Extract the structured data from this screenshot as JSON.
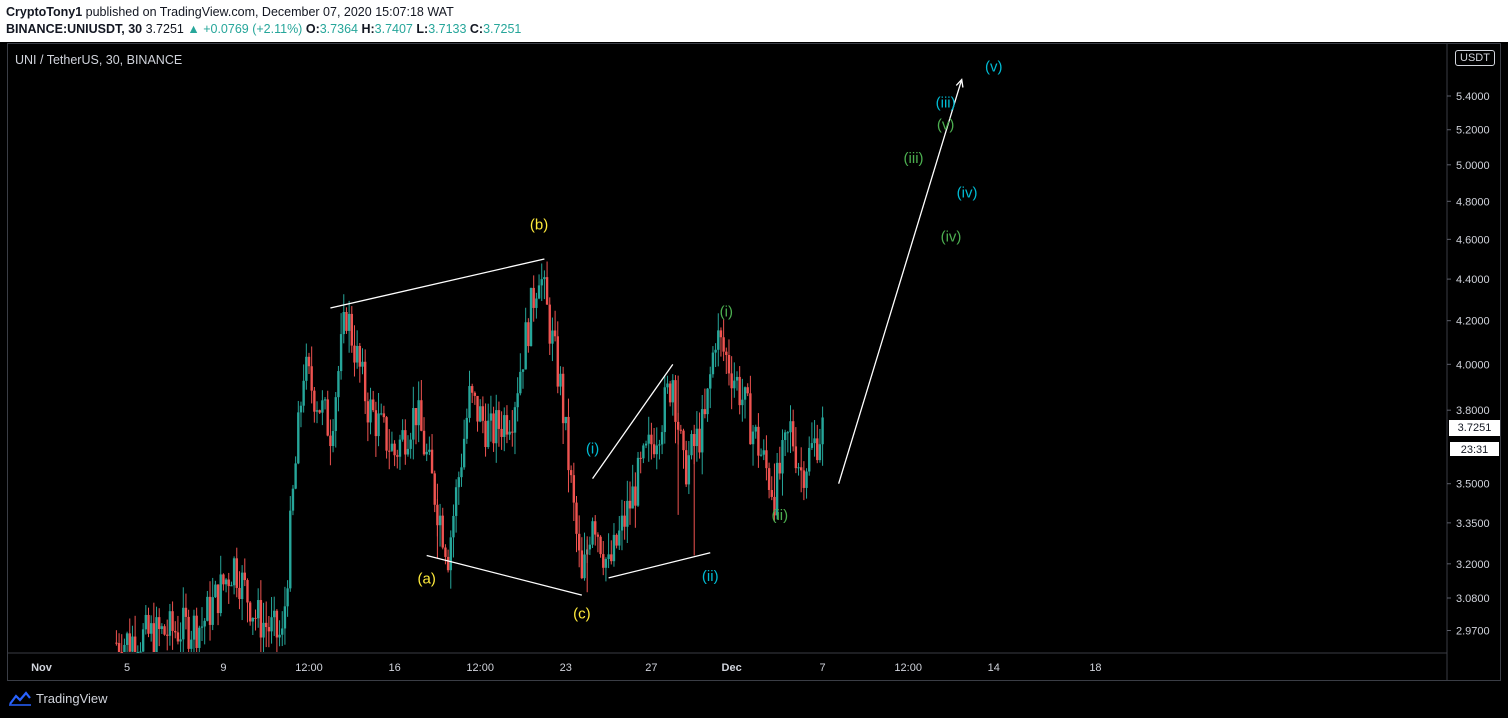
{
  "header": {
    "author": "CryptoTony1",
    "published_text": "published on TradingView.com, December 07, 2020 15:07:18 WAT",
    "ticker": "BINANCE:UNIUSDT, 30",
    "last": "3.7251",
    "change": "+0.0769 (+2.11%)",
    "o_label": "O:",
    "o": "3.7364",
    "h_label": "H:",
    "h": "3.7407",
    "l_label": "L:",
    "l": "3.7133",
    "c_label": "C:",
    "c": "3.7251"
  },
  "symbol_title": "UNI / TetherUS, 30, BINANCE",
  "currency_badge": "USDT",
  "price_tag": "3.7251",
  "countdown": "23:31",
  "footer": {
    "brand": "TradingView"
  },
  "colors": {
    "up": "#26a69a",
    "down": "#ef5350",
    "yellow": "#ffeb3b",
    "cyan": "#00bcd4",
    "green": "#4caf50",
    "line": "#ffffff"
  },
  "chart_data": {
    "type": "candlestick",
    "title": "UNI / TetherUS, 30, BINANCE",
    "y_scale": "log",
    "ylim": [
      2.9,
      5.6
    ],
    "y_ticks": [
      "5.4000",
      "5.2000",
      "5.0000",
      "4.8000",
      "4.6000",
      "4.4000",
      "4.2000",
      "4.0000",
      "3.8000",
      "3.5000",
      "3.3500",
      "3.2000",
      "3.0800",
      "2.9700"
    ],
    "x_ticks": [
      "Nov",
      "5",
      "9",
      "12:00",
      "16",
      "12:00",
      "23",
      "27",
      "Dec",
      "7",
      "12:00",
      "14",
      "18"
    ],
    "anchors": [
      {
        "x": "2020-11-04 12:00",
        "y": 2.93
      },
      {
        "x": "2020-11-08 12:00",
        "y": 2.99
      },
      {
        "x": "2020-11-10 00:00",
        "y": 3.2
      },
      {
        "x": "2020-11-11 00:00",
        "y": 3.02
      },
      {
        "x": "2020-11-12 06:00",
        "y": 2.94
      },
      {
        "x": "2020-11-12 18:00",
        "y": 3.45
      },
      {
        "x": "2020-11-13 06:00",
        "y": 3.98
      },
      {
        "x": "2020-11-14 12:00",
        "y": 3.72
      },
      {
        "x": "2020-11-15 06:00",
        "y": 4.24
      },
      {
        "x": "2020-11-16 06:00",
        "y": 3.82
      },
      {
        "x": "2020-11-17 12:00",
        "y": 3.62
      },
      {
        "x": "2020-11-18 12:00",
        "y": 3.8
      },
      {
        "x": "2020-11-20 00:00",
        "y": 3.24
      },
      {
        "x": "2020-11-21 00:00",
        "y": 3.85
      },
      {
        "x": "2020-11-22 00:00",
        "y": 3.7
      },
      {
        "x": "2020-11-23 00:00",
        "y": 3.8
      },
      {
        "x": "2020-11-24 06:00",
        "y": 4.46
      },
      {
        "x": "2020-11-25 06:00",
        "y": 3.9
      },
      {
        "x": "2020-11-26 06:00",
        "y": 3.12
      },
      {
        "x": "2020-11-26 18:00",
        "y": 3.4
      },
      {
        "x": "2020-11-27 12:00",
        "y": 3.18
      },
      {
        "x": "2020-11-29 00:00",
        "y": 3.55
      },
      {
        "x": "2020-11-30 00:00",
        "y": 3.78
      },
      {
        "x": "2020-11-30 12:00",
        "y": 3.95
      },
      {
        "x": "2020-12-01 00:00",
        "y": 3.55
      },
      {
        "x": "2020-12-02 00:00",
        "y": 3.75
      },
      {
        "x": "2020-12-02 12:00",
        "y": 4.14
      },
      {
        "x": "2020-12-03 12:00",
        "y": 3.92
      },
      {
        "x": "2020-12-04 12:00",
        "y": 3.65
      },
      {
        "x": "2020-12-05 06:00",
        "y": 3.46
      },
      {
        "x": "2020-12-06 00:00",
        "y": 3.72
      },
      {
        "x": "2020-12-06 12:00",
        "y": 3.55
      },
      {
        "x": "2020-12-07 12:00",
        "y": 3.7251
      }
    ],
    "wicks": [
      {
        "x": "2020-11-19 12:00",
        "low": 3.22,
        "high": 3.5
      },
      {
        "x": "2020-11-26 12:00",
        "low": 3.1,
        "high": 3.3
      },
      {
        "x": "2020-11-30 18:00",
        "low": 3.38,
        "high": 3.95
      },
      {
        "x": "2020-12-01 12:00",
        "low": 3.23,
        "high": 3.65
      },
      {
        "x": "2020-12-05 06:00",
        "low": 3.44,
        "high": 3.58
      }
    ],
    "trendlines": [
      {
        "x1": "2020-11-14 12:00",
        "y1": 4.26,
        "x2": "2020-11-24 12:00",
        "y2": 4.5
      },
      {
        "x1": "2020-11-19 00:00",
        "y1": 3.23,
        "x2": "2020-11-26 06:00",
        "y2": 3.09
      },
      {
        "x1": "2020-11-26 18:00",
        "y1": 3.52,
        "x2": "2020-11-30 12:00",
        "y2": 4.0
      },
      {
        "x1": "2020-11-27 12:00",
        "y1": 3.15,
        "x2": "2020-12-02 06:00",
        "y2": 3.24
      },
      {
        "x1": "2020-12-08 06:00",
        "y1": 3.5,
        "x2": "2020-12-14 00:00",
        "y2": 5.5
      }
    ],
    "annotations": [
      {
        "text": "(b)",
        "x": "2020-11-24 06:00",
        "y": 4.65,
        "color": "yellow"
      },
      {
        "text": "(a)",
        "x": "2020-11-19 00:00",
        "y": 3.13,
        "color": "yellow"
      },
      {
        "text": "(c)",
        "x": "2020-11-26 06:00",
        "y": 3.01,
        "color": "yellow"
      },
      {
        "text": "(i)",
        "x": "2020-11-26 18:00",
        "y": 3.62,
        "color": "cyan"
      },
      {
        "text": "(ii)",
        "x": "2020-12-02 06:00",
        "y": 3.14,
        "color": "cyan"
      },
      {
        "text": "(iii)",
        "x": "2020-12-13 06:00",
        "y": 5.33,
        "color": "cyan"
      },
      {
        "text": "(iv)",
        "x": "2020-12-14 06:00",
        "y": 4.82,
        "color": "cyan"
      },
      {
        "text": "(v)",
        "x": "2020-12-15 12:00",
        "y": 5.55,
        "color": "cyan"
      },
      {
        "text": "(i)",
        "x": "2020-12-03 00:00",
        "y": 4.22,
        "color": "green"
      },
      {
        "text": "(ii)",
        "x": "2020-12-05 12:00",
        "y": 3.36,
        "color": "green"
      },
      {
        "text": "(iii)",
        "x": "2020-12-11 18:00",
        "y": 5.01,
        "color": "green"
      },
      {
        "text": "(iv)",
        "x": "2020-12-13 12:00",
        "y": 4.59,
        "color": "green"
      },
      {
        "text": "(v)",
        "x": "2020-12-13 06:00",
        "y": 5.2,
        "color": "green"
      }
    ],
    "last_close": 3.7251
  }
}
